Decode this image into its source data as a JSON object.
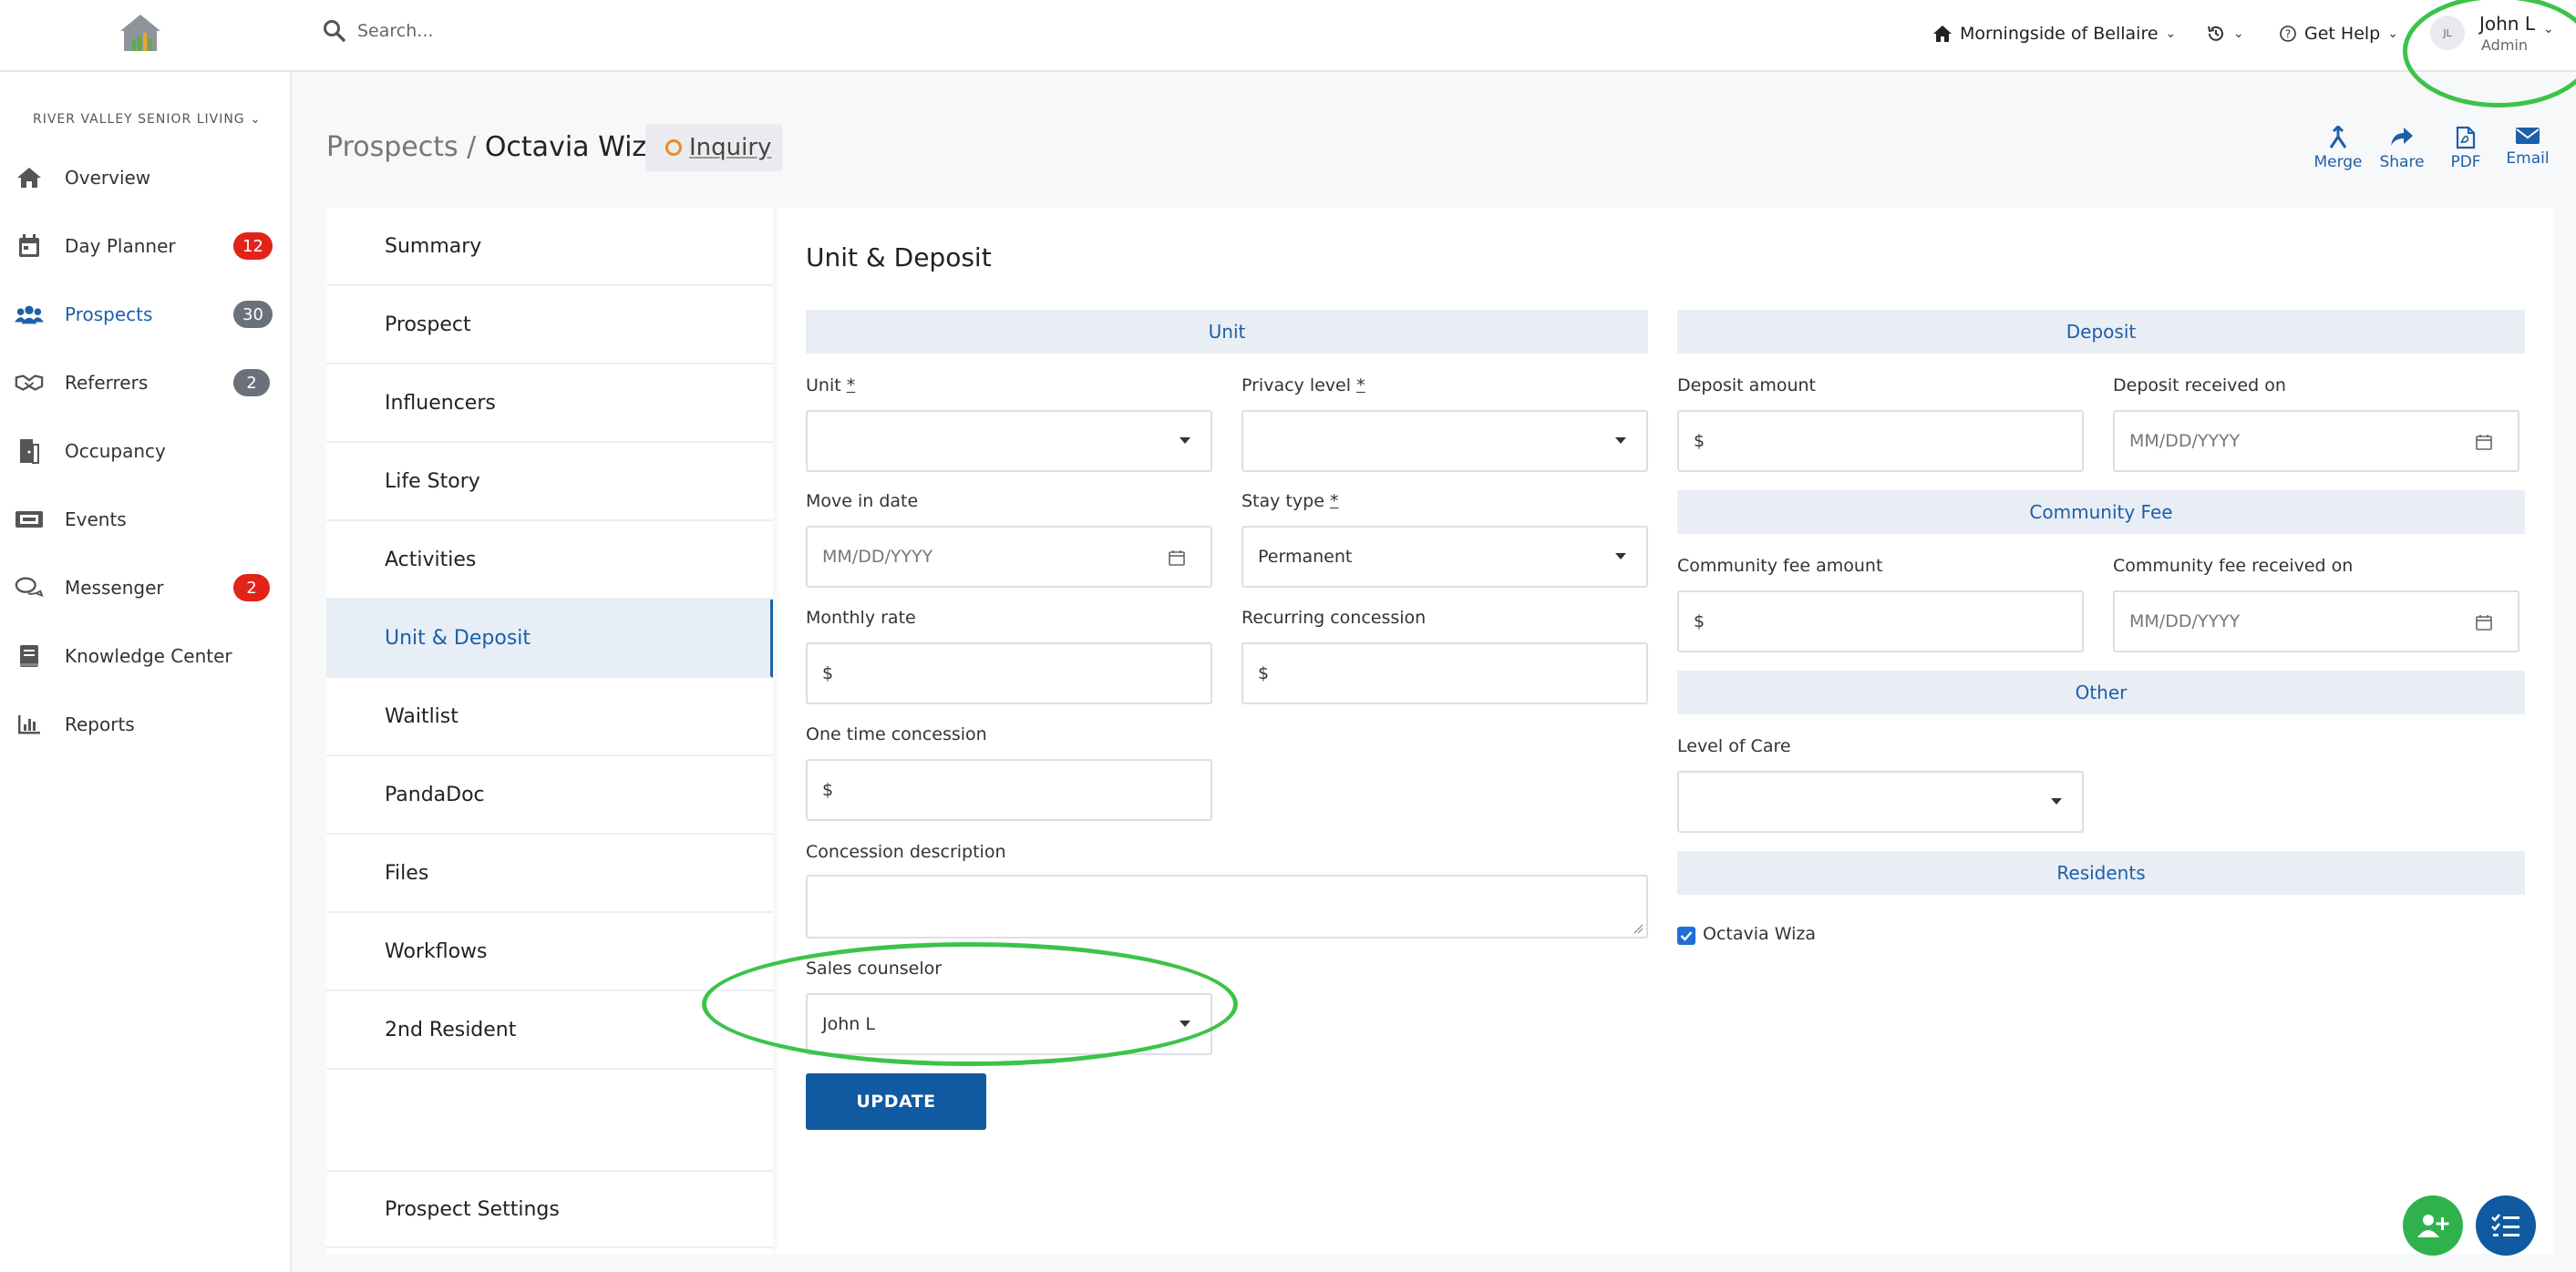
{
  "topbar": {
    "search_placeholder": "Search...",
    "community": "Morningside of Bellaire",
    "help_label": "Get Help",
    "user": {
      "initials": "JL",
      "name": "John L",
      "role": "Admin"
    }
  },
  "sidebar": {
    "org": "RIVER VALLEY SENIOR LIVING",
    "items": [
      {
        "label": "Overview",
        "icon": "home-icon",
        "badge": ""
      },
      {
        "label": "Day Planner",
        "icon": "calendar-icon",
        "badge": "12"
      },
      {
        "label": "Prospects",
        "icon": "users-icon",
        "badge": "30",
        "active": true
      },
      {
        "label": "Referrers",
        "icon": "handshake-icon",
        "badge": "2"
      },
      {
        "label": "Occupancy",
        "icon": "door-icon",
        "badge": ""
      },
      {
        "label": "Events",
        "icon": "ticket-icon",
        "badge": ""
      },
      {
        "label": "Messenger",
        "icon": "chat-icon",
        "badge": "2"
      },
      {
        "label": "Knowledge Center",
        "icon": "book-icon",
        "badge": ""
      },
      {
        "label": "Reports",
        "icon": "bar-chart-icon",
        "badge": ""
      }
    ]
  },
  "header": {
    "crumb_root": "Prospects",
    "crumb_sep": "/",
    "prospect_name": "Octavia Wiza",
    "status": "Inquiry",
    "actions": {
      "merge": "Merge",
      "share": "Share",
      "pdf": "PDF",
      "email": "Email"
    }
  },
  "tabs": [
    "Summary",
    "Prospect",
    "Influencers",
    "Life Story",
    "Activities",
    "Unit & Deposit",
    "Waitlist",
    "PandaDoc",
    "Files",
    "Workflows",
    "2nd Resident"
  ],
  "tab_settings": "Prospect Settings",
  "main": {
    "title": "Unit & Deposit",
    "sections": {
      "unit": "Unit",
      "deposit": "Deposit",
      "community_fee": "Community Fee",
      "other": "Other",
      "residents": "Residents"
    },
    "labels": {
      "unit": "Unit",
      "privacy": "Privacy level",
      "required_mark": "*",
      "move_in": "Move in date",
      "stay_type": "Stay type",
      "monthly_rate": "Monthly rate",
      "recurring": "Recurring concession",
      "one_time": "One time concession",
      "concession_desc": "Concession description",
      "sales_counselor": "Sales counselor",
      "deposit_amount": "Deposit amount",
      "deposit_received": "Deposit received on",
      "fee_amount": "Community fee amount",
      "fee_received": "Community fee received on",
      "level_of_care": "Level of Care"
    },
    "values": {
      "date_placeholder": "MM/DD/YYYY",
      "currency": "$",
      "stay_type": "Permanent",
      "sales_counselor": "John L"
    },
    "resident": "Octavia Wiza",
    "update_label": "UPDATE"
  },
  "colors": {
    "accent": "#1d5fa8",
    "badge_red": "#e2231a",
    "fab_green": "#2fb24c",
    "annotation": "#3cc34a"
  }
}
